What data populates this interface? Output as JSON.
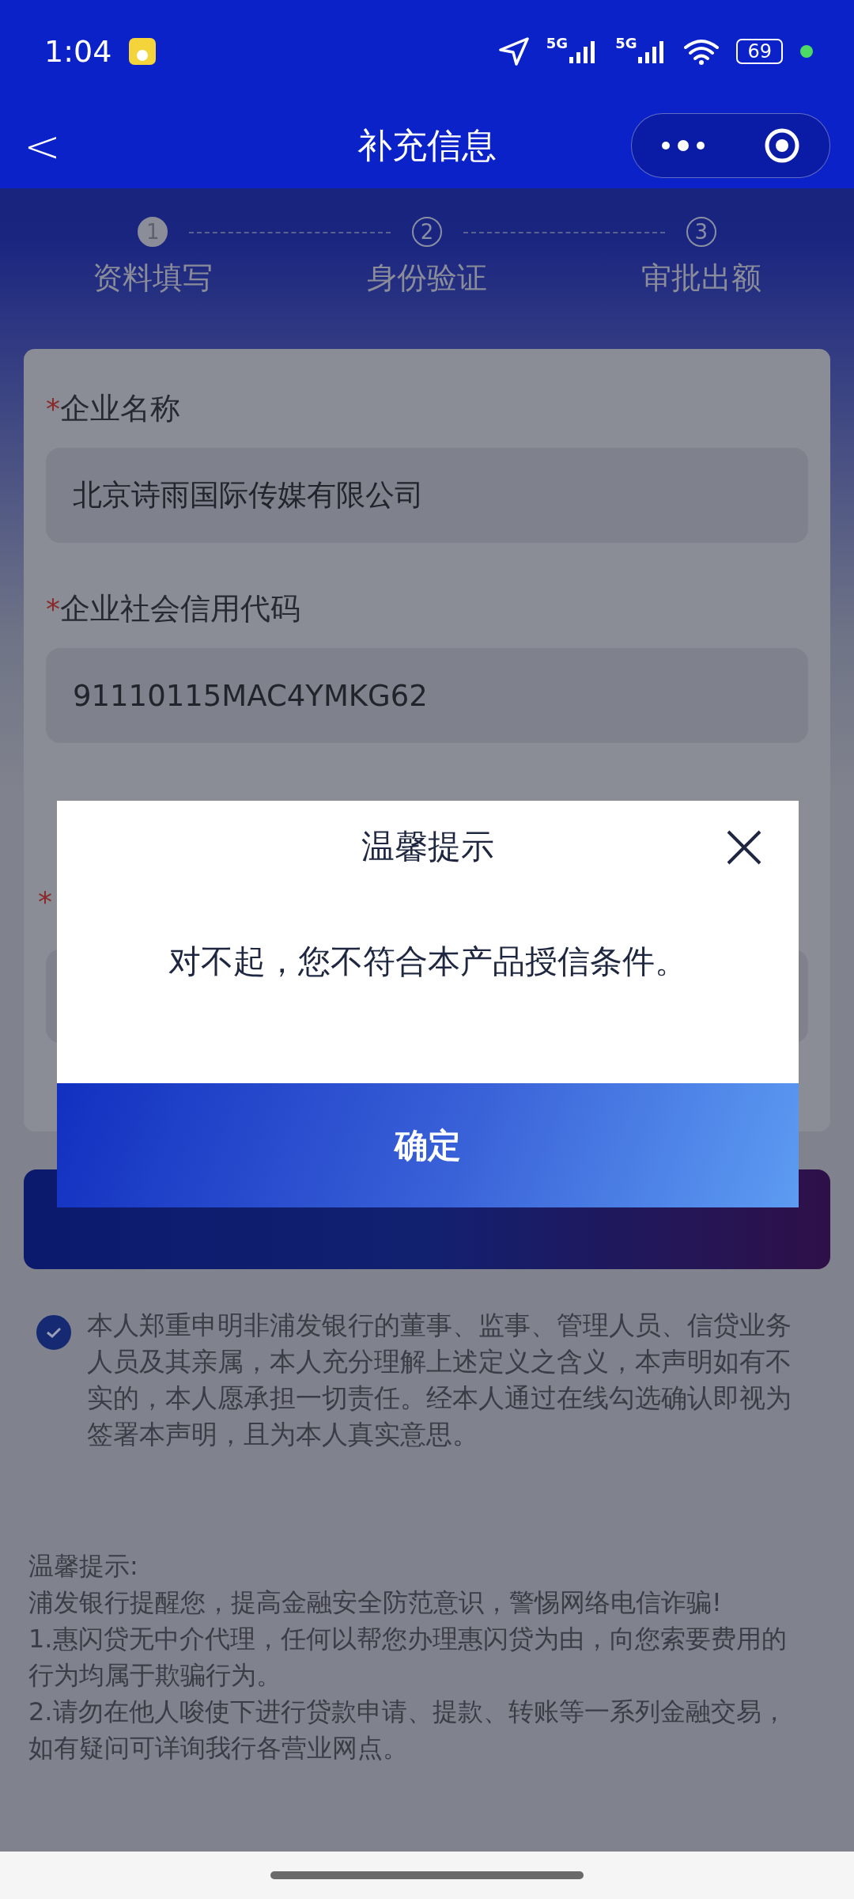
{
  "status_bar": {
    "time": "1:04",
    "signal_labels": [
      "5G",
      "5G"
    ],
    "battery": "69"
  },
  "nav": {
    "back": "<",
    "title": "补充信息"
  },
  "steps": [
    {
      "number": "1",
      "label": "资料填写",
      "active": true
    },
    {
      "number": "2",
      "label": "身份验证",
      "active": false
    },
    {
      "number": "3",
      "label": "审批出额",
      "active": false
    }
  ],
  "form": {
    "fields": [
      {
        "required_mark": "*",
        "label": "企业名称",
        "value": "北京诗雨国际传媒有限公司"
      },
      {
        "required_mark": "*",
        "label": "企业社会信用代码",
        "value": "91110115MAC4YMKG62"
      }
    ],
    "hidden_field": {
      "required_mark": "*"
    }
  },
  "declaration": {
    "checked": true,
    "text": "本人郑重申明非浦发银行的董事、监事、管理人员、信贷业务人员及其亲属，本人充分理解上述定义之含义，本声明如有不实的，本人愿承担一切责任。经本人通过在线勾选确认即视为签署本声明，且为本人真实意思。"
  },
  "tips": {
    "title": "温馨提示:",
    "lines": [
      "浦发银行提醒您，提高金融安全防范意识，警惕网络电信诈骗!",
      "1.惠闪贷无中介代理，任何以帮您办理惠闪贷为由，向您索要费用的行为均属于欺骗行为。",
      "2.请勿在他人唆使下进行贷款申请、提款、转账等一系列金融交易，如有疑问可详询我行各营业网点。"
    ]
  },
  "dialog": {
    "title": "温馨提示",
    "message": "对不起，您不符合本产品授信条件。",
    "confirm": "确定"
  }
}
